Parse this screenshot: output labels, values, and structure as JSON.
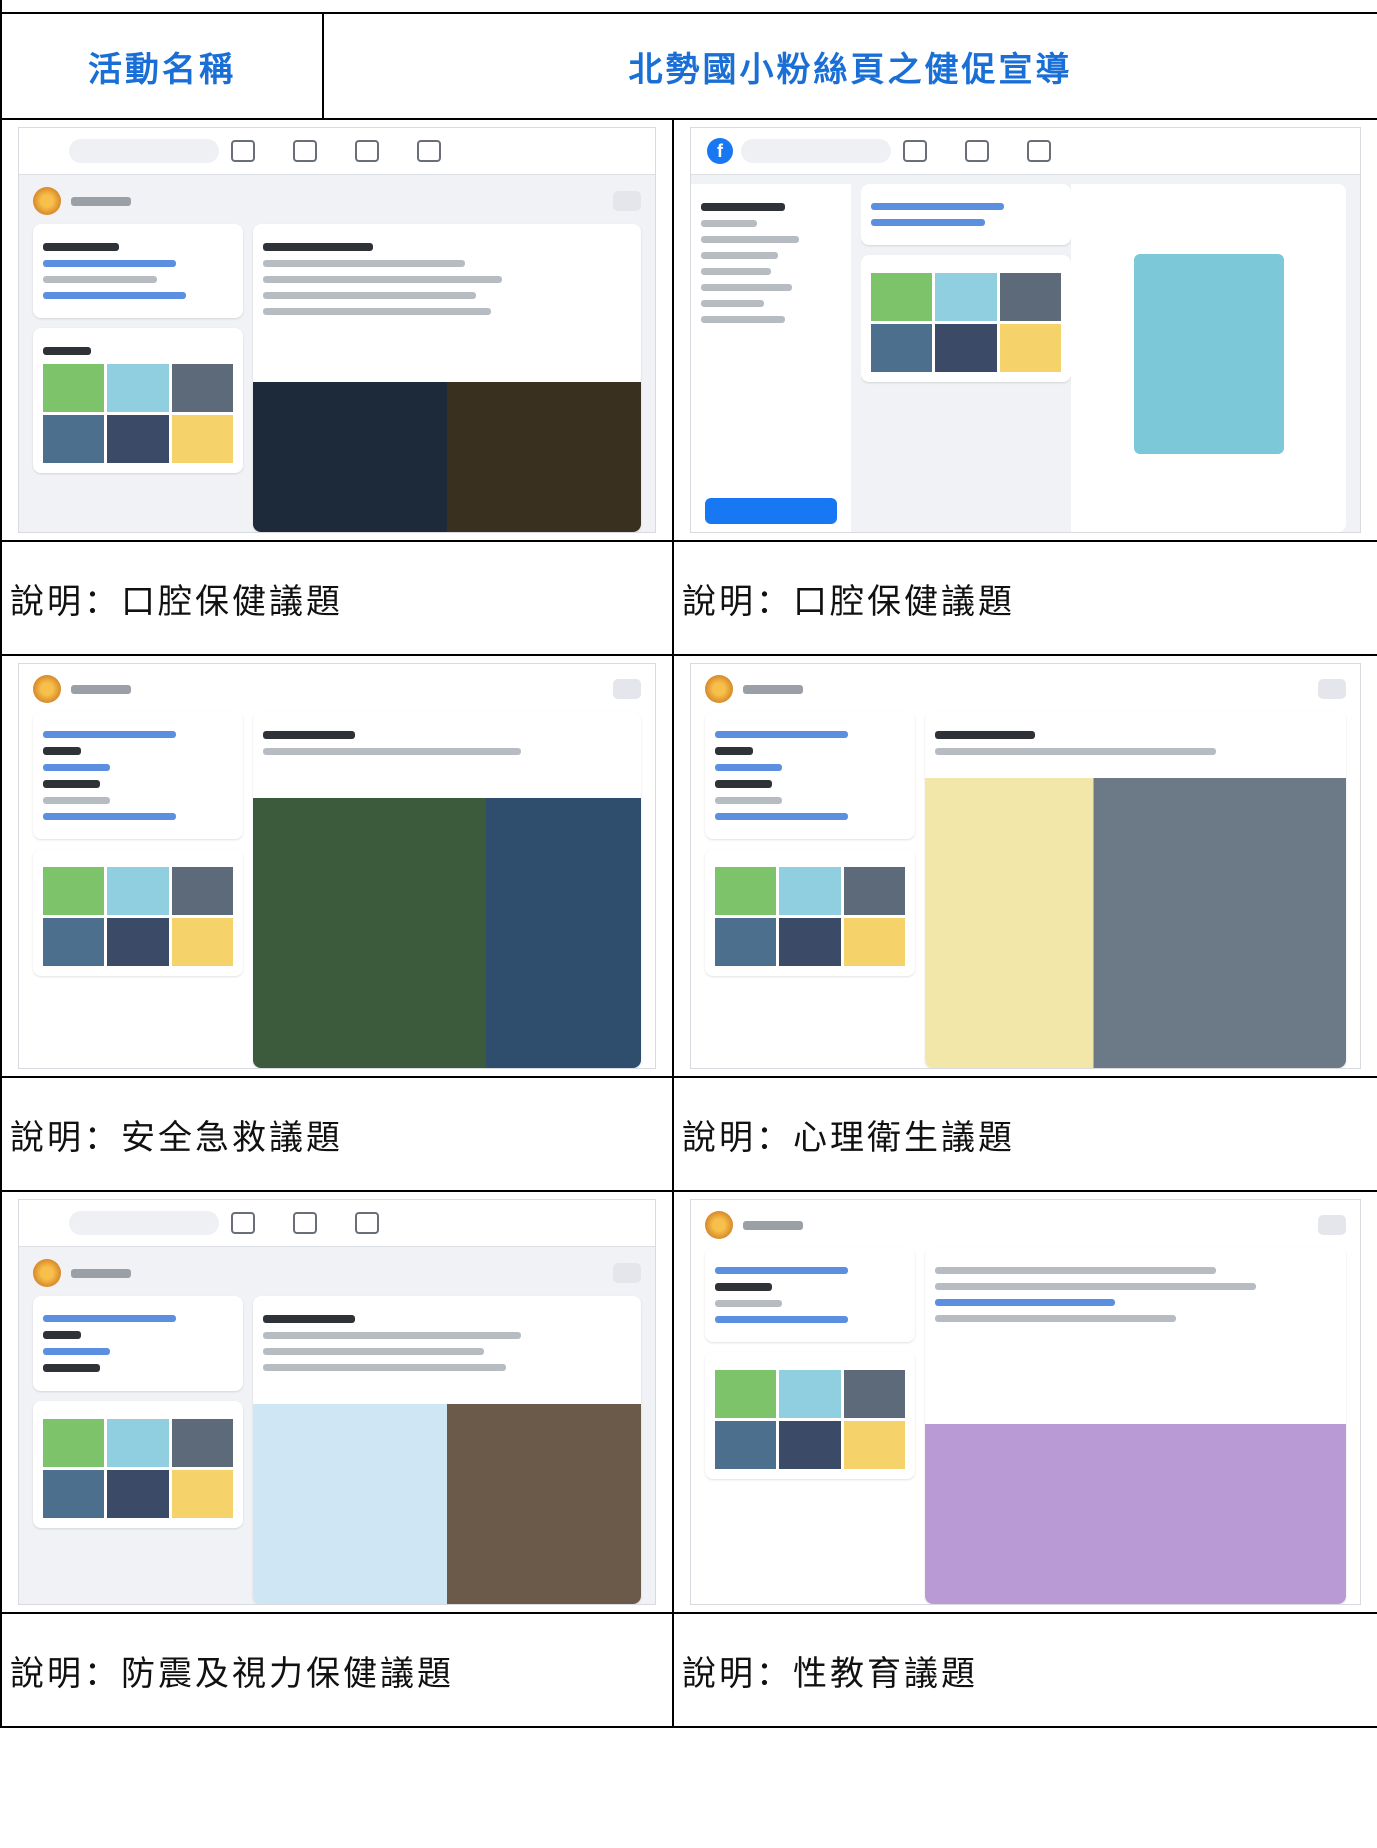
{
  "header": {
    "label": "活動名稱",
    "title": "北勢國小粉絲頁之健促宣導"
  },
  "rows": [
    {
      "left_caption": "說明：口腔保健議題",
      "right_caption": "說明：口腔保健議題"
    },
    {
      "left_caption": "說明：安全急救議題",
      "right_caption": "說明：心理衛生議題"
    },
    {
      "left_caption": "說明：防震及視力保健議題",
      "right_caption": "說明：性教育議題"
    }
  ],
  "colors": {
    "header_text": "#1a6fd6",
    "facebook_blue": "#1877f2"
  }
}
